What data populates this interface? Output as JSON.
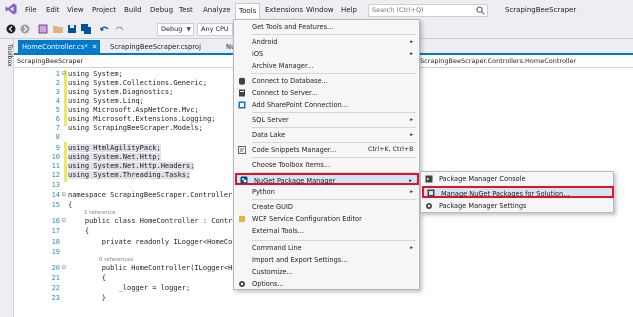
{
  "menubar": {
    "items": [
      "File",
      "Edit",
      "View",
      "Project",
      "Build",
      "Debug",
      "Test",
      "Analyze",
      "Tools",
      "Extensions",
      "Window",
      "Help"
    ],
    "search_placeholder": "Search (Ctrl+Q)",
    "solution_name": "ScrapingBeeScraper"
  },
  "toolbar": {
    "config": "Debug",
    "platform": "Any CPU"
  },
  "toolbox": {
    "label": "Toolbox"
  },
  "tabs": [
    {
      "label": "HomeController.cs*",
      "close": "✕"
    },
    {
      "label": "ScrapingBeeScraper.csproj"
    },
    {
      "label": "NuGet"
    }
  ],
  "navbar": {
    "project": "ScrapingBeeScraper",
    "class": "ScrapingBeeScraper.Controllers.HomeController"
  },
  "code": {
    "lines": [
      {
        "n": "1",
        "text": "using System;"
      },
      {
        "n": "2",
        "text": "using System.Collections.Generic;"
      },
      {
        "n": "3",
        "text": "using System.Diagnostics;"
      },
      {
        "n": "4",
        "text": "using System.Linq;"
      },
      {
        "n": "5",
        "text": "using Microsoft.AspNetCore.Mvc;"
      },
      {
        "n": "6",
        "text": "using Microsoft.Extensions.Logging;"
      },
      {
        "n": "7",
        "text": "using ScrapingBeeScraper.Models;"
      },
      {
        "n": "8",
        "text": ""
      },
      {
        "n": "9",
        "text": "using HtmlAgilityPack;"
      },
      {
        "n": "10",
        "text": "using System.Net.Http;"
      },
      {
        "n": "11",
        "text": "using System.Net.Http.Headers;"
      },
      {
        "n": "12",
        "text": "using System.Threading.Tasks;"
      },
      {
        "n": "13",
        "text": ""
      },
      {
        "n": "14",
        "text": "namespace ScrapingBeeScraper.Controllers"
      },
      {
        "n": "15",
        "text": "{"
      },
      {
        "n": "16",
        "text": "    public class HomeController : Contro"
      },
      {
        "n": "17",
        "text": "    {"
      },
      {
        "n": "18",
        "text": "        private readonly ILogger<HomeCon"
      },
      {
        "n": "19",
        "text": ""
      },
      {
        "n": "20",
        "text": "        public HomeController(ILogger<Hom"
      },
      {
        "n": "21",
        "text": "        {"
      },
      {
        "n": "22",
        "text": "            _logger = logger;"
      },
      {
        "n": "23",
        "text": "        }"
      }
    ],
    "refs_label": "0 references",
    "refs_label_1": "1 reference"
  },
  "tools_menu": {
    "items": [
      {
        "label": "Get Tools and Features..."
      },
      {
        "label": "Android",
        "submenu": true
      },
      {
        "label": "iOS",
        "submenu": true
      },
      {
        "label": "Archive Manager..."
      },
      {
        "label": "Connect to Database..."
      },
      {
        "label": "Connect to Server..."
      },
      {
        "label": "Add SharePoint Connection..."
      },
      {
        "label": "SQL Server",
        "submenu": true
      },
      {
        "label": "Data Lake",
        "submenu": true
      },
      {
        "label": "Code Snippets Manager...",
        "shortcut": "Ctrl+K, Ctrl+B"
      },
      {
        "label": "Choose Toolbox Items..."
      },
      {
        "label": "NuGet Package Manager",
        "submenu": true
      },
      {
        "label": "Python",
        "submenu": true
      },
      {
        "label": "Create GUID"
      },
      {
        "label": "WCF Service Configuration Editor"
      },
      {
        "label": "External Tools..."
      },
      {
        "label": "Command Line",
        "submenu": true
      },
      {
        "label": "Import and Export Settings..."
      },
      {
        "label": "Customize..."
      },
      {
        "label": "Options..."
      }
    ],
    "submenu_arrow": "▸"
  },
  "nuget_submenu": {
    "items": [
      {
        "label": "Package Manager Console"
      },
      {
        "label": "Manage NuGet Packages for Solution..."
      },
      {
        "label": "Package Manager Settings"
      }
    ]
  },
  "colors": {
    "accent": "#007acc",
    "highlight_border": "#e81123",
    "menu_bg": "#f6f6f6",
    "chrome_bg": "#eeeef2"
  }
}
